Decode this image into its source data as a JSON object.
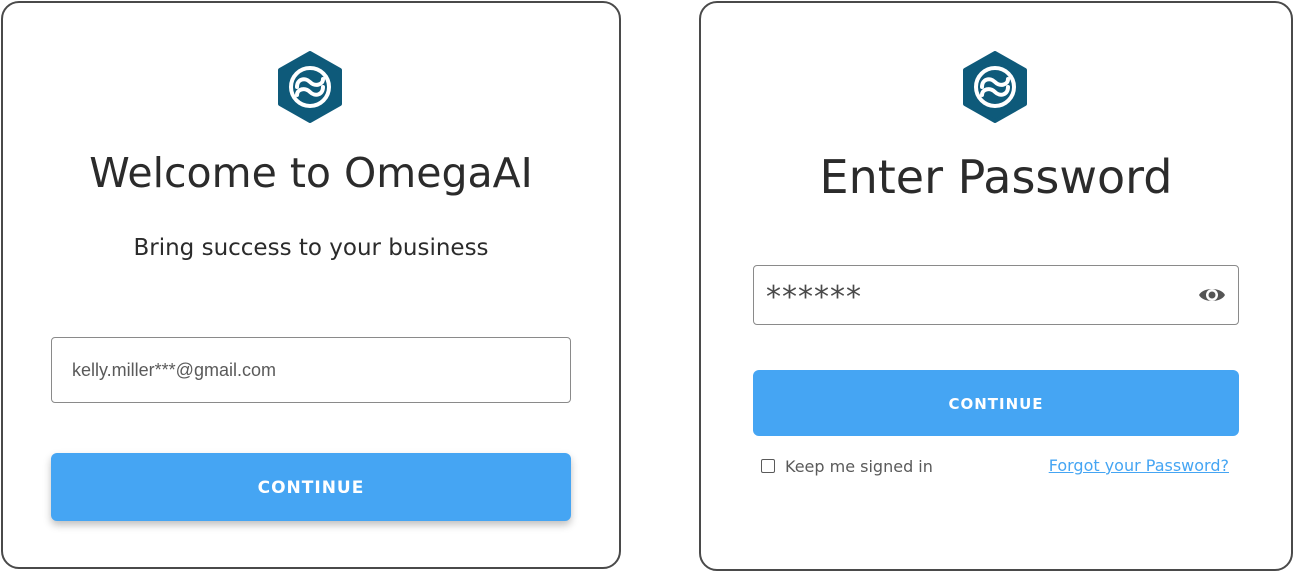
{
  "email_screen": {
    "title": "Welcome to OmegaAI",
    "subtitle": "Bring success to your business",
    "email_field": {
      "value": "",
      "placeholder": "kelly.miller***@gmail.com"
    },
    "continue_label": "CONTINUE"
  },
  "password_screen": {
    "title": "Enter Password",
    "password_field": {
      "masked_value": "******"
    },
    "continue_label": "CONTINUE",
    "keep_signed_in_label": "Keep me signed in",
    "keep_signed_in_checked": false,
    "forgot_password_label": "Forgot your Password?"
  },
  "icons": {
    "logo": "omegaai-logo",
    "toggle_visibility": "eye-icon"
  },
  "colors": {
    "accent": "#45a5f3",
    "logo": "#0e5a7a",
    "text": "#2b2b2b",
    "border": "#4a4a4a"
  }
}
